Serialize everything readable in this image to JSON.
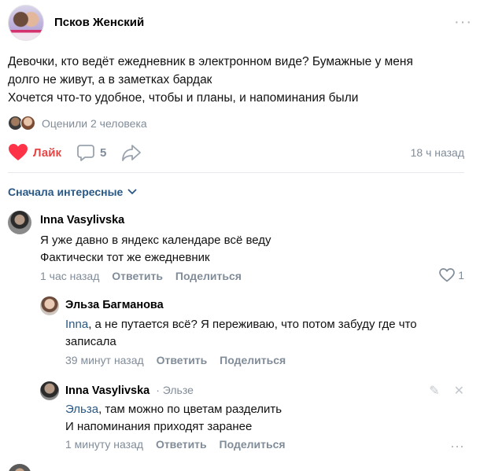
{
  "post": {
    "group_name": "Псков Женский",
    "more_icon": "more-dots-icon",
    "text_lines": [
      "Девочки, кто ведёт ежедневник в электронном виде? Бумажные у меня",
      "долго не живут, а в заметках бардак",
      "Хочется что-то удобное, чтобы и планы, и напоминания были"
    ],
    "likers_text": "Оценили 2 человека",
    "like_label": "Лайк",
    "comments_count": "5",
    "time": "18 ч назад"
  },
  "sort_label": "Сначала интересные",
  "comments": [
    {
      "author": "Inna Vasylivska",
      "lines": [
        "Я уже давно в яндекс календаре всё веду",
        "Фактически тот же ежедневник"
      ],
      "time": "1 час назад",
      "reply": "Ответить",
      "share": "Поделиться",
      "likes": "1"
    },
    {
      "author": "Эльза Багманова",
      "mention": "Inna",
      "line1_rest": ", а не путается всё? Я переживаю, что потом забуду где что",
      "line2": "записала",
      "time": "39 минут назад",
      "reply": "Ответить",
      "share": "Поделиться"
    },
    {
      "author": "Inna Vasylivska",
      "reply_to": "· Эльзе",
      "mention": "Эльза",
      "line1_rest": ", там можно по цветам разделить",
      "line2": "И напоминания приходят заранее",
      "time": "1 минуту назад",
      "reply": "Ответить",
      "share": "Поделиться"
    }
  ],
  "colors": {
    "accent": "#2a5885",
    "like": "#e64646",
    "muted": "#818c99"
  }
}
